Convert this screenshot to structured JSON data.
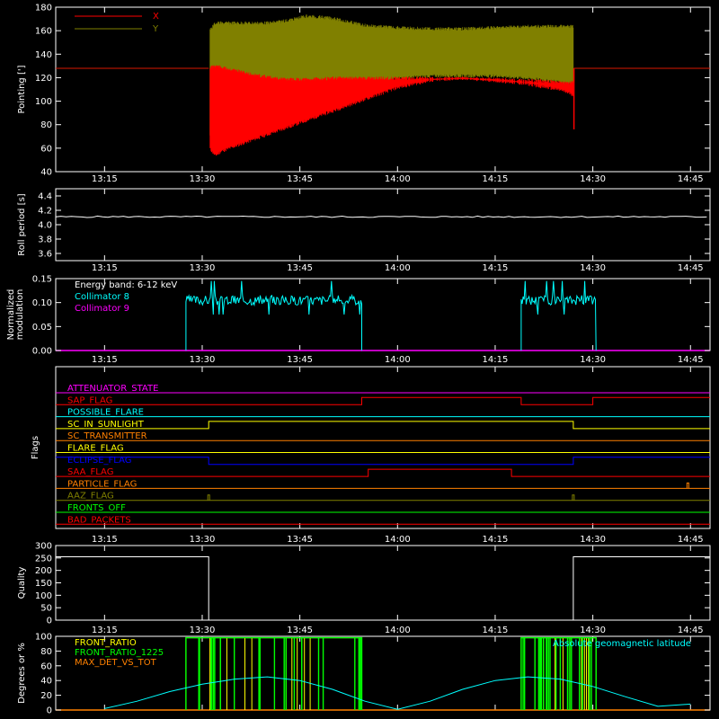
{
  "colors": {
    "background": "#000000",
    "axis": "#ffffff",
    "x_series": "#ff0000",
    "y_series": "#808000",
    "trace": "#ffffff",
    "collimator8": "#00ffff",
    "collimator9": "#ff00ff",
    "latitude": "#00ffff",
    "front_ratio": "#ffff00",
    "front_ratio_1225": "#00ff00",
    "max_det": "#ff8000"
  },
  "time_ticks": [
    "13:15",
    "13:30",
    "13:45",
    "14:00",
    "14:15",
    "14:30",
    "14:45"
  ],
  "chart_data": [
    {
      "type": "line",
      "id": "pointing",
      "ylabel": "Pointing [']",
      "ylim": [
        40,
        180
      ],
      "yticks": [
        "40",
        "60",
        "80",
        "100",
        "120",
        "140",
        "160",
        "180"
      ],
      "series": [
        {
          "name": "X",
          "color": "#ff0000",
          "time_min": [
            0,
            16,
            16.2,
            17,
            18,
            20,
            22,
            25,
            28,
            31,
            35,
            40,
            45,
            50,
            55,
            60,
            65,
            70,
            72,
            72.1,
            76,
            90
          ],
          "lower": [
            128,
            128,
            58,
            52,
            56,
            60,
            64,
            70,
            76,
            82,
            90,
            100,
            110,
            116,
            118,
            116,
            113,
            108,
            104,
            76,
            128,
            128
          ],
          "upper": [
            128,
            128,
            130,
            132,
            130,
            128,
            125,
            122,
            120,
            120,
            121,
            121,
            121,
            121,
            121,
            120,
            119,
            118,
            117,
            100,
            128,
            128
          ]
        },
        {
          "name": "Y",
          "color": "#808000",
          "time_min": [
            0,
            16,
            16.2,
            17,
            18,
            20,
            22,
            25,
            28,
            31,
            35,
            40,
            45,
            50,
            55,
            60,
            65,
            70,
            72,
            72.1,
            76,
            90
          ],
          "lower": [
            128,
            128,
            70,
            66,
            68,
            72,
            78,
            85,
            92,
            98,
            106,
            113,
            118,
            120,
            120,
            120,
            118,
            115,
            112,
            128,
            128,
            128
          ],
          "upper": [
            128,
            128,
            162,
            168,
            168,
            168,
            168,
            168,
            170,
            174,
            172,
            166,
            164,
            163,
            163,
            164,
            165,
            165,
            165,
            128,
            128,
            128
          ]
        }
      ],
      "legend": "top-left"
    },
    {
      "type": "line",
      "id": "roll",
      "ylabel": "Roll period [s]",
      "ylim": [
        3.5,
        4.5
      ],
      "yticks": [
        "3.6",
        "3.8",
        "4.0",
        "4.2",
        "4.4"
      ],
      "series": [
        {
          "time_min": [
            0,
            90
          ],
          "values": [
            4.11,
            4.11
          ]
        }
      ]
    },
    {
      "type": "line",
      "id": "modulation",
      "ylabel": "Normalized modulation",
      "ylim": [
        0,
        0.15
      ],
      "yticks": [
        "0.00",
        "0.05",
        "0.10",
        "0.15"
      ],
      "annotation": "Energy band: 6-12 keV",
      "series": [
        {
          "name": "Collimator 8",
          "color": "#00ffff",
          "active_intervals_min": [
            [
              12.5,
              39.5
            ],
            [
              64,
              75.5
            ]
          ],
          "level": 0.105,
          "spread": 0.02
        },
        {
          "name": "Collimator 9",
          "color": "#ff00ff",
          "values": [
            0,
            0
          ]
        }
      ]
    },
    {
      "type": "flags",
      "id": "flags",
      "ylabel": "Flags",
      "flags": [
        {
          "name": "ATTENUATOR_STATE",
          "color": "#ff00ff",
          "steps": [
            [
              0,
              0
            ]
          ]
        },
        {
          "name": "SAP_FLAG",
          "color": "#ff0000",
          "steps": [
            [
              0,
              0
            ],
            [
              39.5,
              1
            ],
            [
              64,
              0
            ],
            [
              75,
              1
            ]
          ]
        },
        {
          "name": "POSSIBLE_FLARE",
          "color": "#00ffff",
          "steps": [
            [
              0,
              0
            ]
          ]
        },
        {
          "name": "SC_IN_SUNLIGHT",
          "color": "#ffff00",
          "steps": [
            [
              0,
              0
            ],
            [
              16,
              1
            ],
            [
              72,
              0
            ]
          ]
        },
        {
          "name": "SC_TRANSMITTER",
          "color": "#ff8000",
          "steps": [
            [
              0,
              0
            ]
          ]
        },
        {
          "name": "FLARE_FLAG",
          "color": "#ffff00",
          "steps": [
            [
              0,
              0
            ]
          ]
        },
        {
          "name": "ECLIPSE_FLAG",
          "color": "#0000ff",
          "steps": [
            [
              0,
              1
            ],
            [
              16,
              0
            ],
            [
              72,
              1
            ]
          ]
        },
        {
          "name": "SAA_FLAG",
          "color": "#ff0000",
          "steps": [
            [
              0,
              0
            ],
            [
              40.5,
              1
            ],
            [
              62.5,
              0
            ]
          ]
        },
        {
          "name": "PARTICLE_FLAG",
          "color": "#ff8000",
          "steps": [
            [
              0,
              0
            ]
          ],
          "spikes_min": [
            89.6
          ]
        },
        {
          "name": "AAZ_FLAG",
          "color": "#808000",
          "steps": [
            [
              0,
              0
            ]
          ],
          "spikes_min": [
            16,
            72
          ]
        },
        {
          "name": "FRONTS_OFF",
          "color": "#00ff00",
          "steps": [
            [
              0,
              0
            ]
          ]
        },
        {
          "name": "BAD_PACKETS",
          "color": "#ff0000",
          "steps": [
            [
              0,
              0
            ]
          ]
        }
      ]
    },
    {
      "type": "line",
      "id": "quality",
      "ylabel": "Quality",
      "ylim": [
        0,
        300
      ],
      "yticks": [
        "0",
        "50",
        "100",
        "150",
        "200",
        "250",
        "300"
      ],
      "series": [
        {
          "time_min": [
            0,
            16,
            16,
            72,
            72,
            90
          ],
          "values": [
            255,
            255,
            0,
            0,
            255,
            255
          ]
        }
      ]
    },
    {
      "type": "line",
      "id": "ratios",
      "ylabel": "Degrees or %",
      "ylim": [
        0,
        100
      ],
      "yticks": [
        "0",
        "20",
        "40",
        "60",
        "80",
        "100"
      ],
      "annotation": "Absolute geomagnetic latitude",
      "series": [
        {
          "name": "FRONT_RATIO",
          "color": "#ffff00",
          "active_intervals_min": [
            [
              12.5,
              39.5
            ],
            [
              64,
              75.5
            ]
          ],
          "level": 98
        },
        {
          "name": "FRONT_RATIO_1225",
          "color": "#00ff00",
          "active_intervals_min": [
            [
              12.5,
              39.5
            ],
            [
              64,
              75.5
            ]
          ],
          "level": 98
        },
        {
          "name": "MAX_DET_VS_TOT",
          "color": "#ff8000",
          "values": [
            0,
            0
          ]
        },
        {
          "name": "Absolute geomagnetic latitude",
          "color": "#00ffff",
          "time_min": [
            0,
            5,
            10,
            15,
            20,
            25,
            30,
            35,
            40,
            45,
            50,
            55,
            60,
            65,
            70,
            75,
            80,
            85,
            90
          ],
          "values": [
            2,
            12,
            25,
            35,
            42,
            45,
            40,
            28,
            12,
            1,
            12,
            28,
            40,
            45,
            42,
            32,
            18,
            5,
            8
          ]
        }
      ]
    }
  ]
}
